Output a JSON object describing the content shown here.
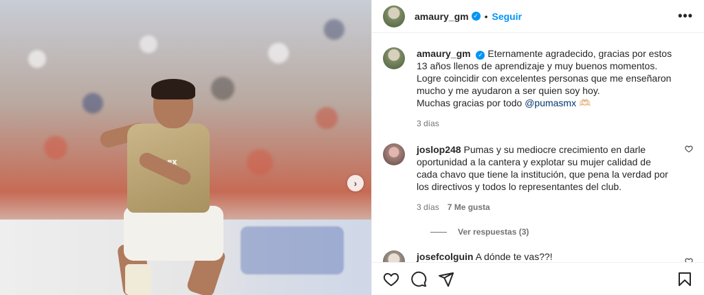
{
  "post_header": {
    "username": "amaury_gm",
    "verified_symbol": "✓",
    "separator": "•",
    "follow_label": "Seguir",
    "more_label": "•••"
  },
  "media": {
    "next_label": "›",
    "jersey_text": "ex"
  },
  "caption": {
    "username": "amaury_gm",
    "text": "Eternamente agradecido, gracias por estos 13 años llenos de aprendizaje y muy buenos momentos. Logre coincidir con excelentes personas que me enseñaron mucho y me ayudaron a ser quien soy hoy.",
    "text2": "Muchas gracias por todo",
    "mention": "@pumasmx",
    "emoji": "🫶🏻",
    "time": "3 días"
  },
  "comments": [
    {
      "username": "joslop248",
      "text": "Pumas y su mediocre crecimiento en darle oportunidad a la cantera y explotar su mujer calidad de cada chavo que tiene la institución, que pena la verdad por los directivos y todos lo representantes del club.",
      "time": "3 días",
      "likes": "7 Me gusta",
      "replies_label": "Ver respuestas (3)"
    },
    {
      "username": "josefcolguin",
      "text": "A dónde te vas??!"
    }
  ],
  "icons": {
    "like": "heart-icon",
    "comment": "comment-icon",
    "share": "share-icon",
    "save": "bookmark-icon"
  },
  "colors": {
    "accent": "#0095f6",
    "text": "#262626",
    "muted": "#737373",
    "link": "#00376b"
  }
}
